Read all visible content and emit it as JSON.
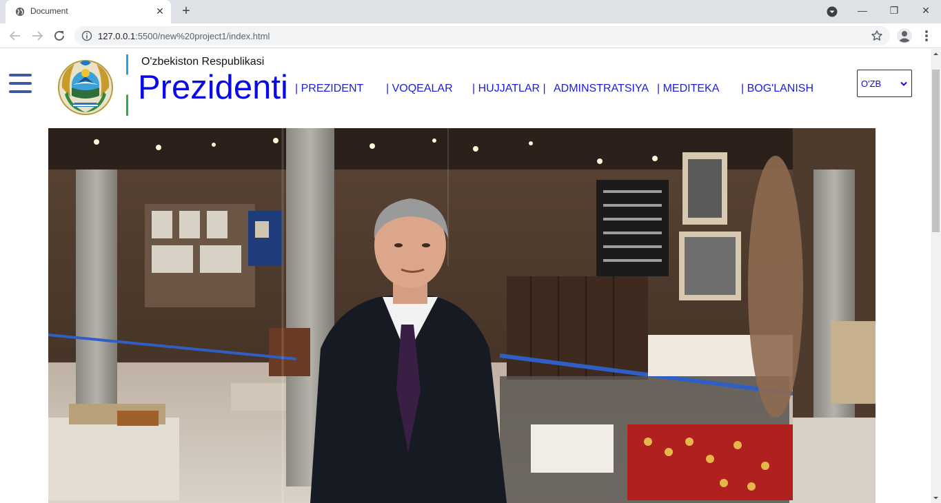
{
  "browser": {
    "tab_title": "Document",
    "url_host": "127.0.0.1",
    "url_rest": ":5500/new%20project1/index.html"
  },
  "site": {
    "republic": "O'zbekiston Respublikasi",
    "brand": "Prezidenti",
    "nav": [
      {
        "label": "| PREZIDENT"
      },
      {
        "label": "| VOQEALAR"
      },
      {
        "label": "| HUJJATLAR |"
      },
      {
        "label": "ADMINSTRATSIYA"
      },
      {
        "label": "| MEDITEKA"
      },
      {
        "label": "| BOG'LANISH"
      }
    ],
    "language": {
      "selected": "O'ZB"
    }
  },
  "colors": {
    "brand": "#0a0ae6",
    "nav_link": "#1c1ce0",
    "hamburger": "#3d5a9e"
  }
}
